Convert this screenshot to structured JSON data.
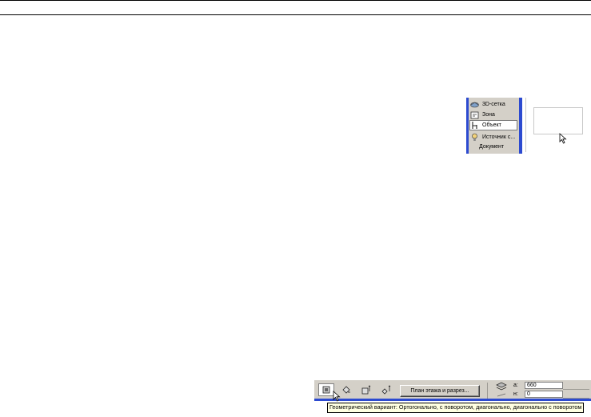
{
  "toolbox": {
    "items": [
      {
        "label": "3D-сетка",
        "icon": "mesh-3d-icon"
      },
      {
        "label": "Зона",
        "icon": "zone-icon"
      },
      {
        "label": "Объект",
        "icon": "object-chair-icon",
        "selected": true
      },
      {
        "label": "Источник с...",
        "icon": "lamp-icon"
      }
    ],
    "section_label": "Документ"
  },
  "infobox": {
    "geometry_buttons": [
      "orthogonal-icon",
      "rotated-icon",
      "diagonal-icon",
      "diagonal-rotated-icon"
    ],
    "plan_button_label": "План этажа и разрез...",
    "field_a_label": "a:",
    "field_a_value": "660",
    "field_h_label": "н:",
    "field_h_value": "0",
    "tooltip": "Геометрический вариант: Ортогонально, с поворотом, диагонально, диагонально с поворотом"
  },
  "colors": {
    "accent_blue": "#2c4ad0",
    "panel_gray": "#d4d0c8",
    "tooltip_bg": "#ffffe1"
  }
}
